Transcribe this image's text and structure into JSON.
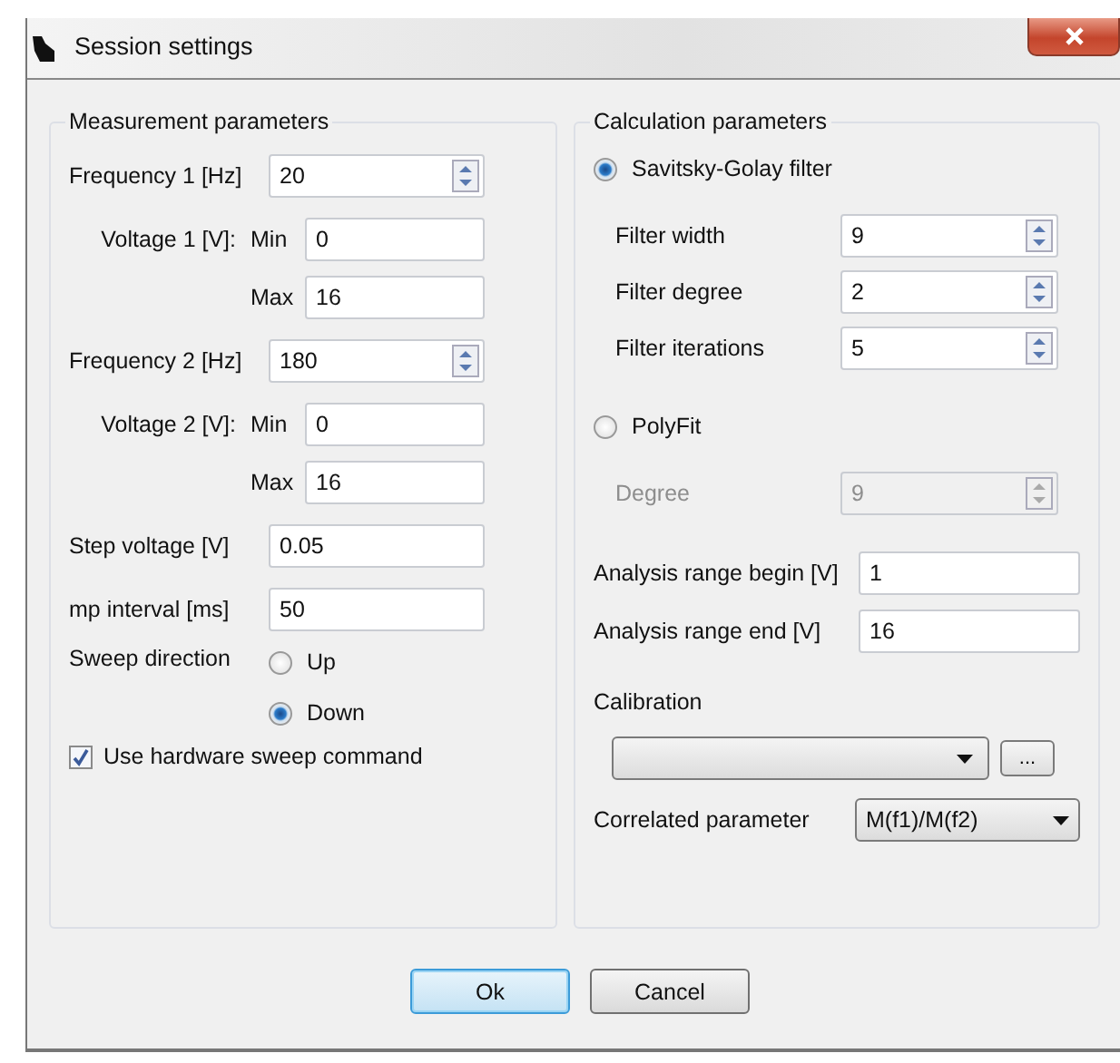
{
  "window": {
    "title": "Session settings"
  },
  "measurement": {
    "title": "Measurement parameters",
    "rows": [
      {
        "kind": "spin",
        "label": "Frequency 1 [Hz]",
        "value": "20"
      },
      {
        "kind": "range",
        "label": "Voltage 1 [V]:",
        "sublabel": "Min",
        "value": "0"
      },
      {
        "kind": "range",
        "sublabel": "Max",
        "value": "16"
      },
      {
        "kind": "spin",
        "label": "Frequency 2 [Hz]",
        "value": "180"
      },
      {
        "kind": "range",
        "label": "Voltage 2 [V]:",
        "sublabel": "Min",
        "value": "0"
      },
      {
        "kind": "range",
        "sublabel": "Max",
        "value": "16"
      },
      {
        "kind": "text",
        "label": "Step voltage [V]",
        "value": "0.05"
      },
      {
        "kind": "text",
        "label": "mp interval [ms]",
        "value": "50"
      }
    ],
    "sweep": {
      "label": "Sweep direction",
      "options": [
        {
          "label": "Up",
          "selected": false
        },
        {
          "label": "Down",
          "selected": true
        }
      ]
    },
    "hardware_sweep": {
      "label": "Use hardware sweep command",
      "checked": true
    }
  },
  "calculation": {
    "title": "Calculation parameters",
    "methods": [
      {
        "label": "Savitsky-Golay filter",
        "selected": true,
        "fields": [
          {
            "label": "Filter width",
            "value": "9",
            "disabled": false
          },
          {
            "label": "Filter degree",
            "value": "2",
            "disabled": false
          },
          {
            "label": "Filter iterations",
            "value": "5",
            "disabled": false
          }
        ]
      },
      {
        "label": "PolyFit",
        "selected": false,
        "fields": [
          {
            "label": "Degree",
            "value": "9",
            "disabled": true
          }
        ]
      }
    ],
    "ranges": [
      {
        "label": "Analysis range begin [V]",
        "value": "1"
      },
      {
        "label": "Analysis range end [V]",
        "value": "16"
      }
    ],
    "calibration": {
      "label": "Calibration",
      "browse": "..."
    },
    "correlated": {
      "label": "Correlated parameter",
      "value": "M(f1)/M(f2)"
    }
  },
  "buttons": [
    {
      "label": "Ok",
      "default": true
    },
    {
      "label": "Cancel",
      "default": false
    }
  ]
}
